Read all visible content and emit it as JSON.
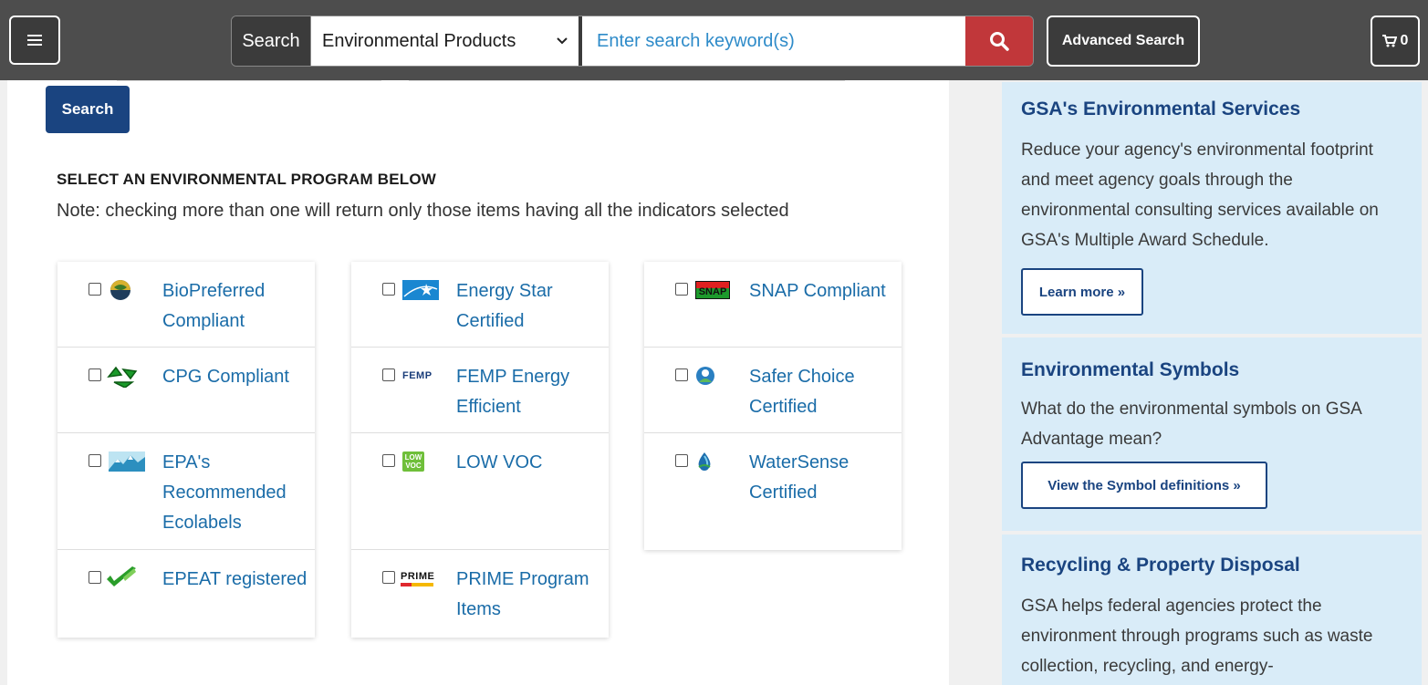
{
  "topbar": {
    "menu_icon": "hamburger-icon",
    "search_label": "Search",
    "category_selected": "Environmental Products",
    "search_placeholder": "Enter search keyword(s)",
    "search_icon": "magnifier-icon",
    "advanced_search": "Advanced Search",
    "cart_icon": "cart-icon",
    "cart_count": "0",
    "colors": {
      "bar": "#4d4d4d",
      "search_button": "#c1373a",
      "placeholder": "#2e8bc9"
    }
  },
  "main": {
    "search_button": "Search",
    "section_title": "SELECT AN ENVIRONMENTAL PROGRAM BELOW",
    "section_note": "Note: checking more than one will return only those items having all the indicators selected",
    "columns": [
      [
        {
          "label": "BioPreferred Compliant",
          "icon": "biopreferred-icon"
        },
        {
          "label": "CPG Compliant",
          "icon": "recycle-icon"
        },
        {
          "label": "EPA's Recommended Ecolabels",
          "icon": "mountains-icon"
        },
        {
          "label": "EPEAT registered",
          "icon": "epeat-check-icon"
        }
      ],
      [
        {
          "label": "Energy Star Certified",
          "icon": "energy-star-icon"
        },
        {
          "label": "FEMP Energy Efficient",
          "icon": "femp-icon",
          "icon_text": "FEMP"
        },
        {
          "label": "LOW VOC",
          "icon": "low-voc-icon",
          "icon_text": "LOW VOC"
        },
        {
          "label": "PRIME Program Items",
          "icon": "prime-icon",
          "icon_text": "PRIME"
        }
      ],
      [
        {
          "label": "SNAP Compliant",
          "icon": "snap-icon",
          "icon_text": "SNAP"
        },
        {
          "label": "Safer Choice Certified",
          "icon": "safer-choice-icon"
        },
        {
          "label": "WaterSense Certified",
          "icon": "water-drop-icon"
        }
      ]
    ],
    "colors": {
      "link": "#1a6ca8",
      "primary_button": "#1a4480"
    }
  },
  "sidebar": {
    "boxes": [
      {
        "title": "GSA's Environmental Services",
        "text": "Reduce your agency's environmental footprint and meet agency goals through the environmental consulting services available on GSA's Multiple Award Schedule.",
        "button": "Learn more »"
      },
      {
        "title": "Environmental Symbols",
        "text": "What do the environmental symbols on GSA Advantage mean?",
        "button": "View the Symbol definitions »"
      },
      {
        "title": "Recycling & Property Disposal",
        "text": "GSA helps federal agencies protect the environment through programs such as waste collection, recycling, and energy-"
      }
    ],
    "colors": {
      "background": "#d9ecf8",
      "heading": "#1a4480"
    }
  }
}
